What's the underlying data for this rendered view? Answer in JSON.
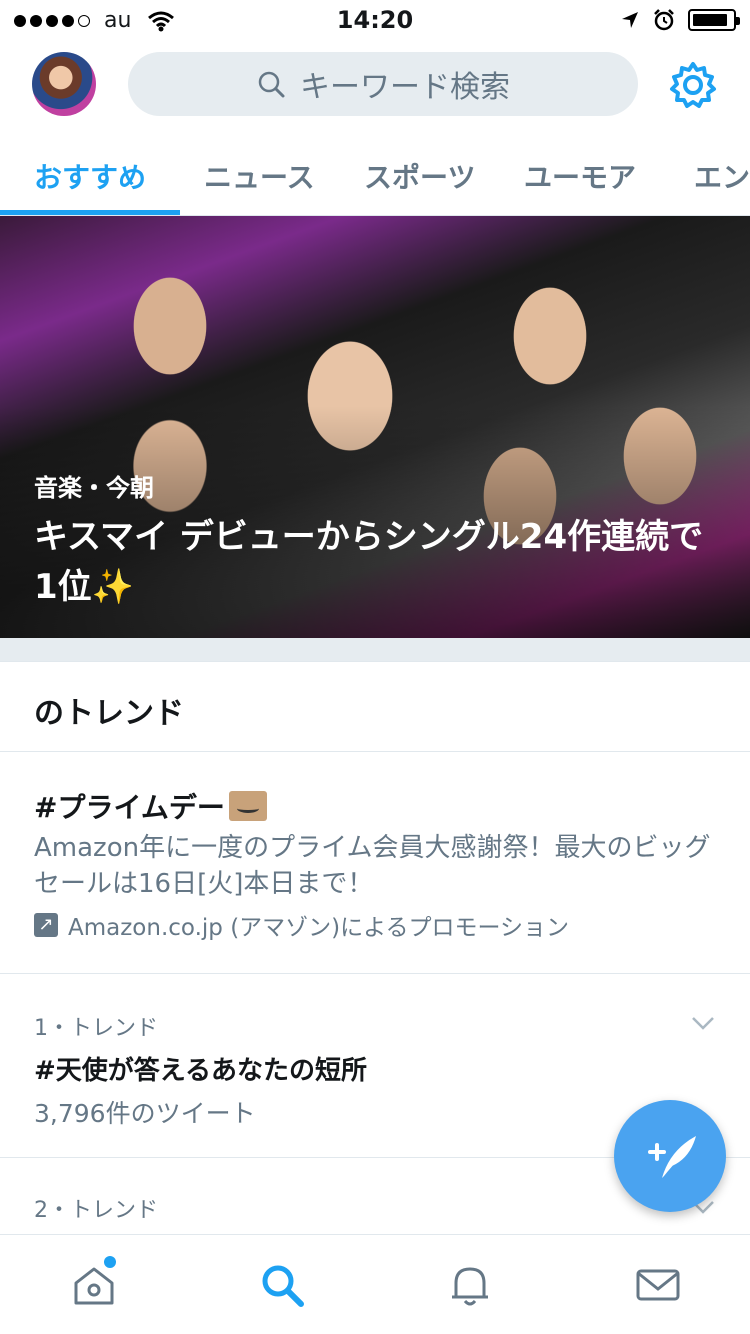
{
  "status_bar": {
    "carrier": "au",
    "time": "14:20"
  },
  "header": {
    "search_placeholder": "キーワード検索"
  },
  "tabs": [
    {
      "label": "おすすめ",
      "active": true
    },
    {
      "label": "ニュース",
      "active": false
    },
    {
      "label": "スポーツ",
      "active": false
    },
    {
      "label": "ユーモア",
      "active": false
    },
    {
      "label": "エン",
      "active": false
    }
  ],
  "hero": {
    "meta": "音楽・今朝",
    "title": "キスマイ デビューからシングル24作連続で1位✨"
  },
  "trends": {
    "header": "のトレンド",
    "promo": {
      "title": "#プライムデー",
      "description": "Amazon年に一度のプライム会員大感謝祭！最大のビッグセールは16日[火]本日まで！",
      "promoted_by": "Amazon.co.jp (アマゾン)によるプロモーション"
    },
    "items": [
      {
        "rank": "1・トレンド",
        "name": "#天使が答えるあなたの短所",
        "count": "3,796件のツイート"
      },
      {
        "rank": "2・トレンド",
        "name": "",
        "count": ""
      }
    ]
  },
  "colors": {
    "accent": "#1da1f2",
    "fab": "#4aa3f0",
    "secondary_text": "#657786",
    "divider": "#e1e8ed",
    "search_bg": "#e6ecf0"
  },
  "icons": {
    "header": [
      "avatar",
      "search-icon",
      "gear-icon"
    ],
    "tabbar": [
      "home-icon",
      "search-icon",
      "bell-icon",
      "mail-icon"
    ],
    "fab": "compose-tweet-icon"
  }
}
